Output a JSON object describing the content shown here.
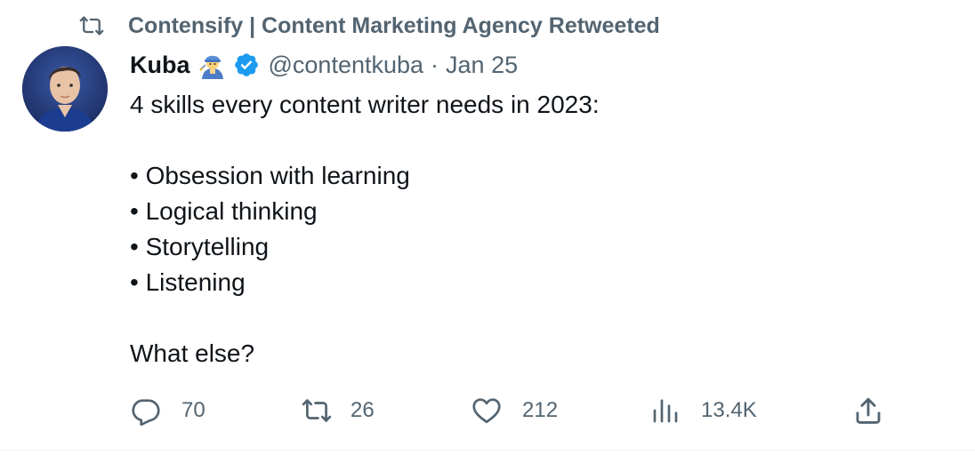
{
  "retweet": {
    "icon": "retweet-icon",
    "text": "Contensify | Content Marketing Agency Retweeted"
  },
  "author": {
    "display_name": "Kuba",
    "emoji_icon": "construction-worker-emoji",
    "verified_icon": "verified-badge-icon",
    "handle": "@contentkuba",
    "separator": "·",
    "date": "Jan 25"
  },
  "tweet": {
    "lines": [
      "4 skills every content writer needs in 2023:",
      "",
      "• Obsession with learning",
      "• Logical thinking",
      "• Storytelling",
      "• Listening",
      "",
      "What else?"
    ]
  },
  "actions": {
    "reply": {
      "icon": "reply-icon",
      "count": "70"
    },
    "retweet": {
      "icon": "retweet-icon",
      "count": "26"
    },
    "like": {
      "icon": "heart-icon",
      "count": "212"
    },
    "views": {
      "icon": "analytics-icon",
      "count": "13.4K"
    },
    "share": {
      "icon": "share-icon"
    }
  },
  "colors": {
    "text_primary": "#0f1419",
    "text_secondary": "#536471",
    "verified_blue": "#1d9bf0"
  }
}
